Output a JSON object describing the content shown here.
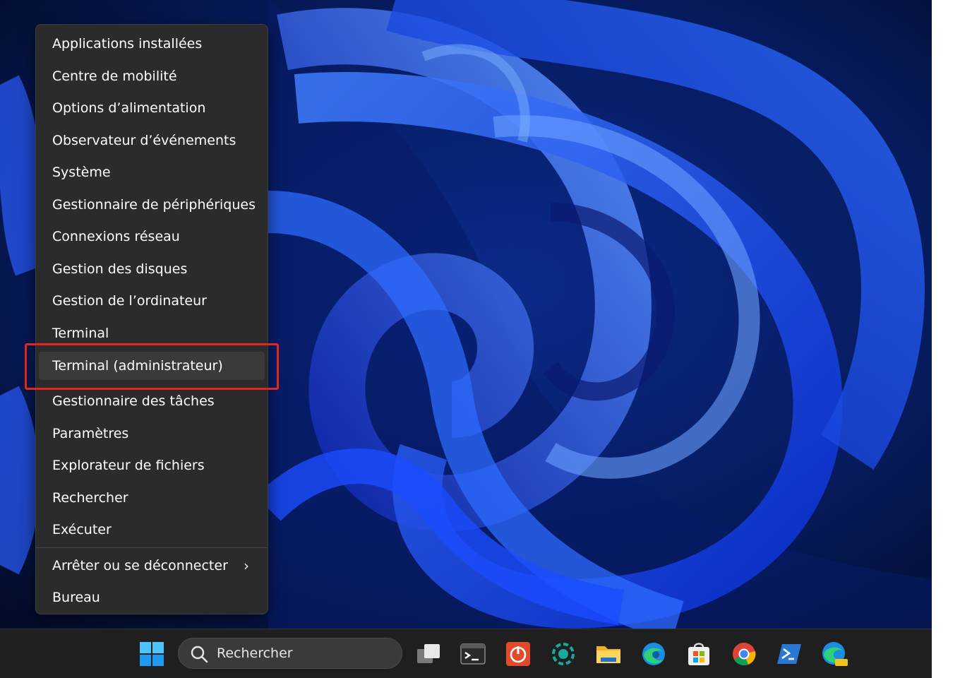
{
  "menu": {
    "items": [
      {
        "label": "Applications installées"
      },
      {
        "label": "Centre de mobilité"
      },
      {
        "label": "Options d’alimentation"
      },
      {
        "label": "Observateur d’événements"
      },
      {
        "label": "Système"
      },
      {
        "label": "Gestionnaire de périphériques"
      },
      {
        "label": "Connexions réseau"
      },
      {
        "label": "Gestion des disques"
      },
      {
        "label": "Gestion de l’ordinateur"
      },
      {
        "label": "Terminal"
      },
      {
        "label": "Terminal (administrateur)",
        "highlighted": true
      },
      {
        "label": "Gestionnaire des tâches"
      },
      {
        "label": "Paramètres"
      },
      {
        "label": "Explorateur de fichiers"
      },
      {
        "label": "Rechercher"
      },
      {
        "label": "Exécuter"
      },
      {
        "label": "Arrêter ou se déconnecter",
        "submenu": true
      },
      {
        "label": "Bureau"
      }
    ],
    "chevron": "›"
  },
  "taskbar": {
    "search_label": "Rechercher",
    "apps": [
      {
        "name": "start-icon"
      },
      {
        "name": "task-view-icon"
      },
      {
        "name": "terminal-icon"
      },
      {
        "name": "power-app-icon"
      },
      {
        "name": "ring-app-icon"
      },
      {
        "name": "file-explorer-icon"
      },
      {
        "name": "edge-icon"
      },
      {
        "name": "store-icon"
      },
      {
        "name": "chrome-icon"
      },
      {
        "name": "powershell-icon"
      },
      {
        "name": "edge-canary-icon"
      }
    ]
  },
  "colors": {
    "accent_highlight": "#e3261c",
    "menu_bg": "#2b2b2b",
    "taskbar_bg": "#1f1f1f"
  }
}
